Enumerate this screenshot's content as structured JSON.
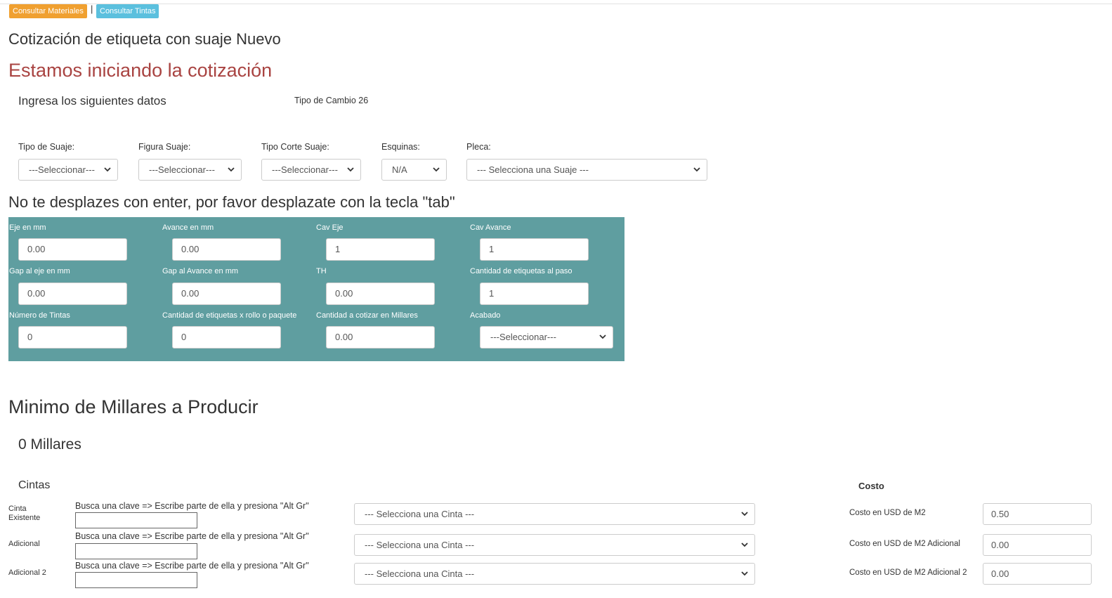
{
  "toolbar": {
    "materials_button": "Consultar Materiales",
    "separator": "|",
    "inks_button": "Consultar Tintas",
    "colors": {
      "materials": "#f0a030",
      "inks": "#5bc0de"
    }
  },
  "header": {
    "title": "Cotización de etiqueta con suaje Nuevo",
    "status": "Estamos iniciando la cotización",
    "intro": "Ingresa los siguientes datos",
    "exchange_rate": "Tipo de Cambio 26"
  },
  "suaje": {
    "tipo_label": "Tipo de Suaje:",
    "tipo_value": "---Seleccionar---",
    "figura_label": "Figura Suaje:",
    "figura_value": "---Seleccionar---",
    "corte_label": "Tipo Corte Suaje:",
    "corte_value": "---Seleccionar---",
    "esquinas_label": "Esquinas:",
    "esquinas_value": "N/A",
    "pleca_label": "Pleca:",
    "pleca_value": "--- Selecciona una Suaje ---"
  },
  "notice": "No te desplazes con enter, por favor desplazate con la tecla \"tab\"",
  "dimensions": {
    "eje_label": "Eje en mm",
    "eje_value": "0.00",
    "avance_label": "Avance en mm",
    "avance_value": "0.00",
    "cav_eje_label": "Cav Eje",
    "cav_eje_value": "1",
    "cav_avance_label": "Cav Avance",
    "cav_avance_value": "1",
    "gap_eje_label": "Gap al eje en mm",
    "gap_eje_value": "0.00",
    "gap_avance_label": "Gap al Avance en mm",
    "gap_avance_value": "0.00",
    "th_label": "TH",
    "th_value": "0.00",
    "etiquetas_paso_label": "Cantidad de etiquetas al paso",
    "etiquetas_paso_value": "1",
    "tintas_label": "Número de Tintas",
    "tintas_value": "0",
    "etiquetas_rollo_label": "Cantidad de etiquetas x rollo o paquete",
    "etiquetas_rollo_value": "0",
    "millares_label": "Cantidad a cotizar en Millares",
    "millares_value": "0.00",
    "acabado_label": "Acabado",
    "acabado_value": "---Seleccionar---",
    "panel_color": "#5f9ea0"
  },
  "minimum": {
    "title": "Minimo de Millares a Producir",
    "value": "0 Millares"
  },
  "cintas": {
    "heading": "Cintas",
    "cost_heading": "Costo",
    "search_hint": "Busca una clave => Escribe parte de ella y presiona \"Alt Gr\"",
    "rows": [
      {
        "label": "Cinta Existente",
        "select": "--- Selecciona una Cinta ---",
        "cost_label": "Costo en USD de M2",
        "cost_value": "0.50"
      },
      {
        "label": "Adicional",
        "select": "--- Selecciona una Cinta ---",
        "cost_label": "Costo en USD de M2 Adicional",
        "cost_value": "0.00"
      },
      {
        "label": "Adicional 2",
        "select": "--- Selecciona una Cinta ---",
        "cost_label": "Costo en USD de M2 Adicional 2",
        "cost_value": "0.00"
      }
    ]
  }
}
